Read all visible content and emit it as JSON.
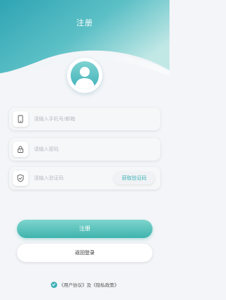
{
  "header": {
    "title": "注册"
  },
  "avatar": {
    "icon": "user-avatar-icon"
  },
  "form": {
    "phone": {
      "icon": "phone-icon",
      "placeholder": "请输入手机号/邮箱",
      "value": ""
    },
    "password": {
      "icon": "lock-icon",
      "placeholder": "请输入密码",
      "value": ""
    },
    "code": {
      "icon": "shield-check-icon",
      "placeholder": "请输入验证码",
      "value": "",
      "button_label": "获取验证码"
    }
  },
  "actions": {
    "register_label": "注册",
    "back_label": "返回登录"
  },
  "agreement": {
    "checked": true,
    "user_agreement": "《用户协议》",
    "joiner": "及",
    "privacy_policy": "《隐私政策》"
  },
  "colors": {
    "accent": "#3fb2b8",
    "header_gradient_start": "#36a9b8",
    "header_gradient_end": "#b9e4e4",
    "background": "#f3f5f8"
  }
}
